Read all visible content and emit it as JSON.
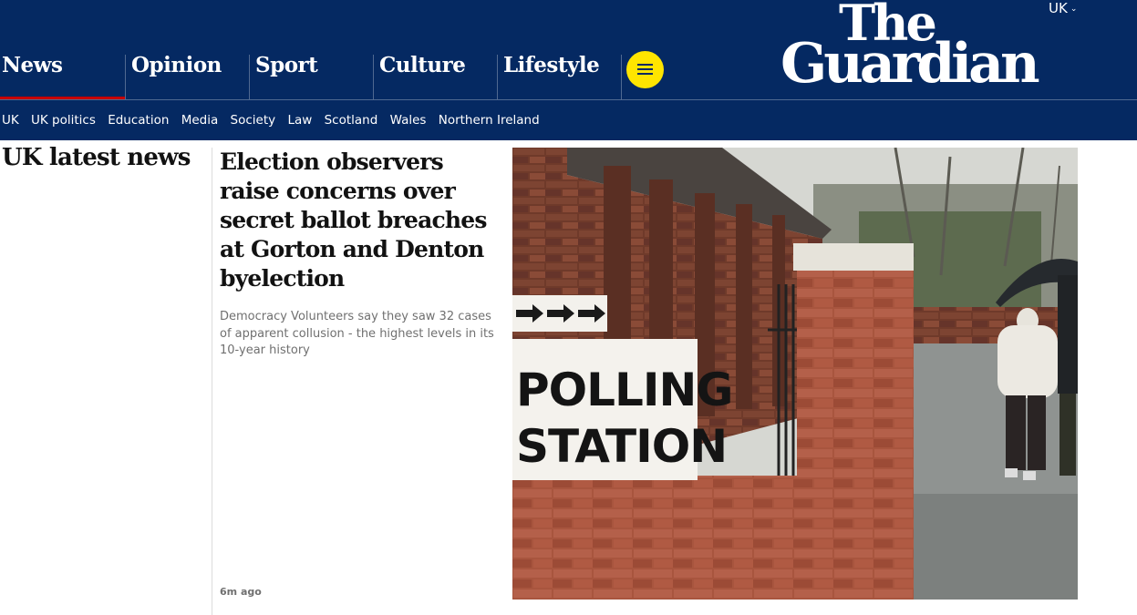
{
  "header": {
    "edition": "UK",
    "logo": {
      "line1": "The",
      "line2": "Guardian"
    },
    "pillars": [
      {
        "label": "News",
        "active": true
      },
      {
        "label": "Opinion",
        "active": false
      },
      {
        "label": "Sport",
        "active": false
      },
      {
        "label": "Culture",
        "active": false
      },
      {
        "label": "Lifestyle",
        "active": false
      }
    ],
    "menu_icon": "hamburger-icon"
  },
  "subnav": [
    "UK",
    "UK politics",
    "Education",
    "Media",
    "Society",
    "Law",
    "Scotland",
    "Wales",
    "Northern Ireland"
  ],
  "section": {
    "title": "UK latest news"
  },
  "article": {
    "headline": "Election observers raise concerns over secret ballot breaches at Gorton and Denton byelection",
    "standfirst": "Democracy Volunteers say they saw 32 cases of apparent collusion - the highest levels in its 10-year history",
    "timestamp": "6m ago",
    "image": {
      "sign_line1": "POLLING",
      "sign_line2": "STATION"
    }
  },
  "colors": {
    "brand_blue": "#052962",
    "menu_yellow": "#ffe500",
    "active_underline": "#c70000"
  }
}
